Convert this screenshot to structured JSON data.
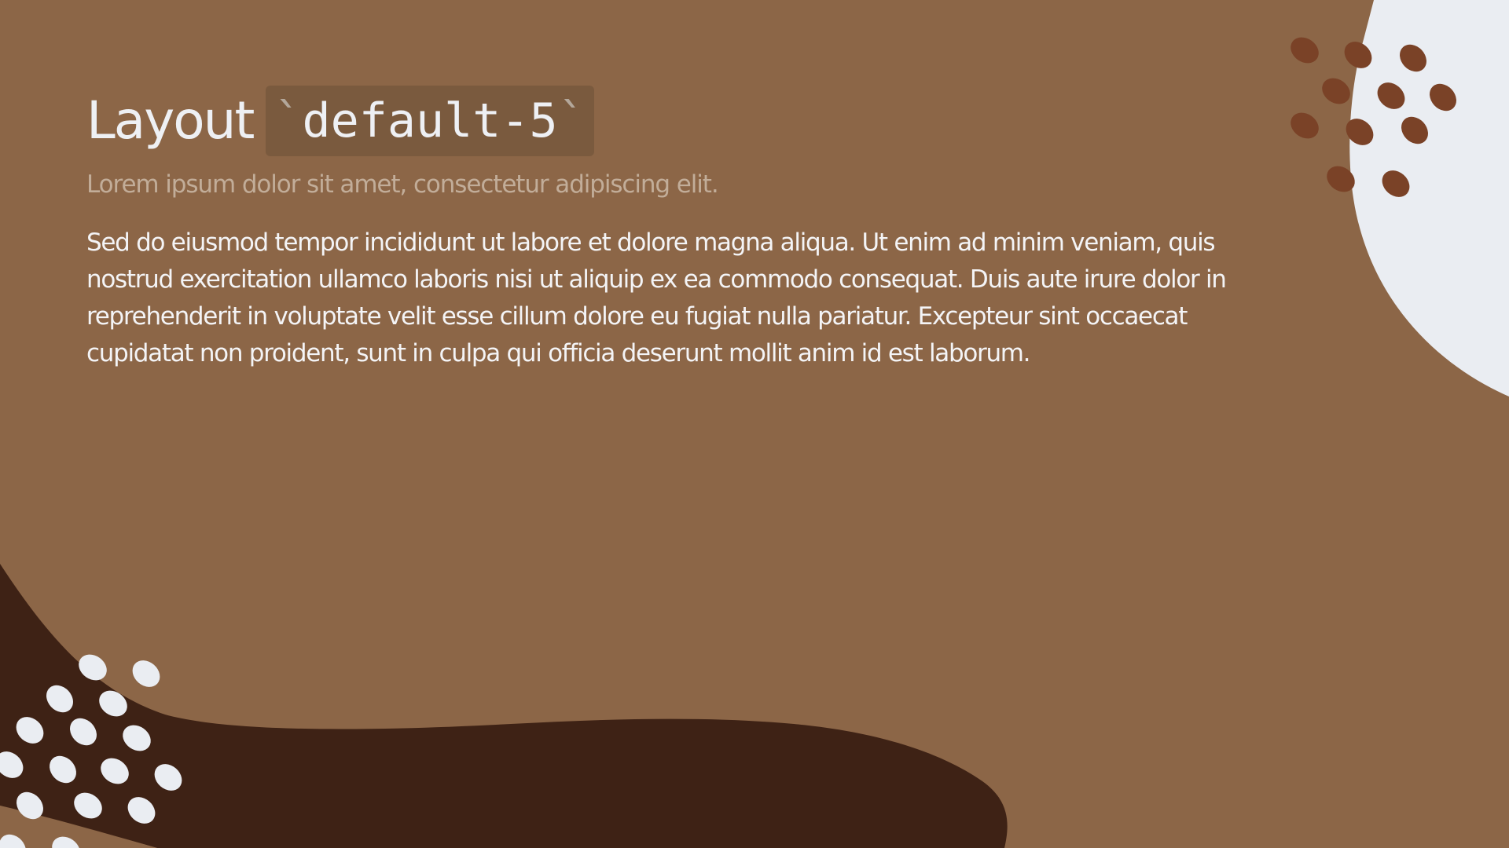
{
  "slide": {
    "title": "Layout",
    "title_code": "default-5",
    "code_tick": "`",
    "subtitle": "Lorem ipsum dolor sit amet, consectetur adipiscing elit.",
    "paragraph": "Sed do eiusmod tempor incididunt ut labore et dolore magna aliqua. Ut enim ad minim veniam, quis nostrud exercitation ullamco laboris nisi ut aliquip ex ea commodo consequat. Duis aute irure dolor in reprehenderit in voluptate velit esse cillum dolore eu fugiat nulla pariatur. Excepteur sint occaecat cupidatat non proident, sunt in culpa qui officia deserunt mollit anim id est laborum."
  },
  "colors": {
    "background": "#8c6647",
    "dark_brown": "#3e2215",
    "light_shape": "#eaedf2",
    "dot_brown": "#7a4227",
    "text": "#eef0f4",
    "subtitle": "#c2ad99",
    "code_background": "#7a5a3e"
  }
}
